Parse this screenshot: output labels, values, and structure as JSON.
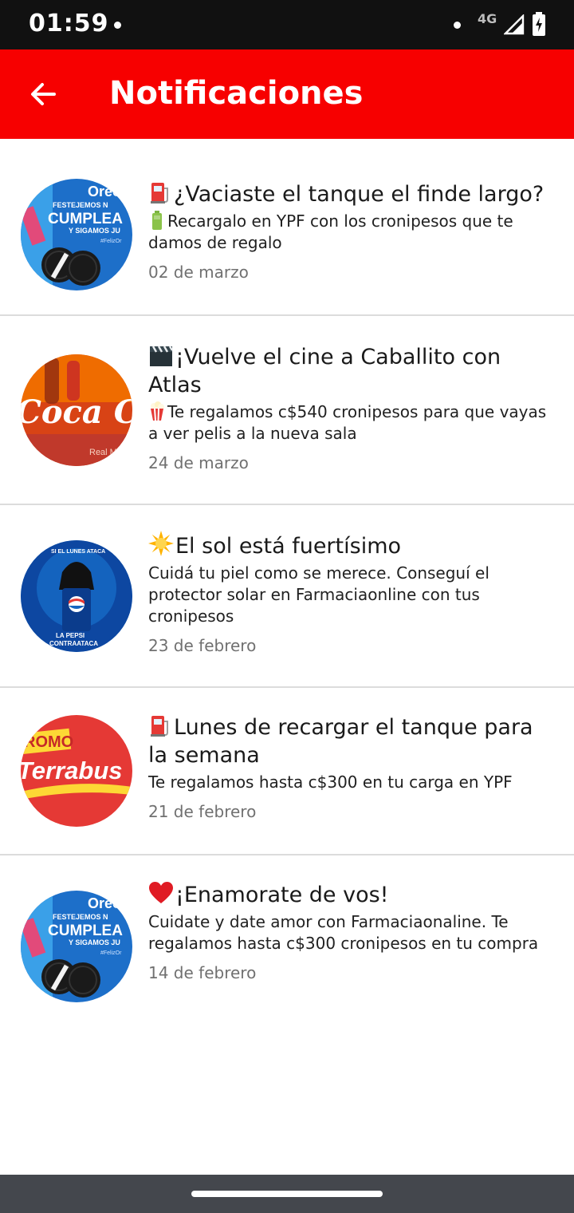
{
  "status_bar": {
    "time": "01:59",
    "network": "4G",
    "icons": [
      "dot-icon",
      "dot-icon",
      "signal-icon",
      "battery-charging-icon"
    ]
  },
  "app_bar": {
    "title": "Notificaciones",
    "back_icon": "arrow-back-icon",
    "background": "#f70000"
  },
  "notifications": [
    {
      "thumbnail": "oreo-cumpleanos",
      "thumbnail_text": [
        "Oreo",
        "FESTEJEMOS N",
        "CUMPLEA",
        "Y SIGAMOS JU",
        "#FelizOr"
      ],
      "title_emoji": "fuel-pump-icon",
      "title": "¿Vaciaste el tanque el finde largo?",
      "text_emoji": "battery-icon",
      "text": "Recargalo en YPF con los cronipesos que te damos de regalo",
      "date": "02 de marzo"
    },
    {
      "thumbnail": "coca-cola",
      "thumbnail_text": [
        "Coca Cola",
        "Real M"
      ],
      "title_emoji": "clapper-board-icon",
      "title": "¡Vuelve el cine a Caballito con Atlas",
      "text_emoji": "popcorn-icon",
      "text": "Te regalamos c$540 cronipesos para que vayas a ver pelis a la nueva sala",
      "date": "24 de marzo"
    },
    {
      "thumbnail": "pepsi",
      "thumbnail_text": [
        "SI EL LUNES ATACA",
        "LA PEPSI",
        "CONTRAATACA"
      ],
      "title_emoji": "sun-icon",
      "title": "El sol está fuertísimo",
      "text_emoji": "",
      "text": "Cuidá tu piel como se merece. Conseguí el protector solar en Farmaciaonline con tus cronipesos",
      "date": "23 de febrero"
    },
    {
      "thumbnail": "terrabusi",
      "thumbnail_text": [
        "ROMO",
        "Terrabus"
      ],
      "title_emoji": "fuel-pump-icon",
      "title": "Lunes de recargar el tanque para la semana",
      "text_emoji": "",
      "text": "Te regalamos hasta c$300 en tu carga en YPF",
      "date": "21 de febrero"
    },
    {
      "thumbnail": "oreo-cumpleanos",
      "thumbnail_text": [
        "Oreo",
        "FESTEJEMOS N",
        "CUMPLEA",
        "Y SIGAMOS JU",
        "#FelizOr"
      ],
      "title_emoji": "red-heart-icon",
      "title": "¡Enamorate de vos!",
      "text_emoji": "",
      "text": "Cuidate y date amor con Farmaciaonaline. Te regalamos hasta c$300 cronipesos en tu compra",
      "date": "14 de febrero"
    }
  ],
  "colors": {
    "accent": "#f70000",
    "divider": "#dcdcdc",
    "date_text": "#707070",
    "nav_bar": "#44474d"
  }
}
